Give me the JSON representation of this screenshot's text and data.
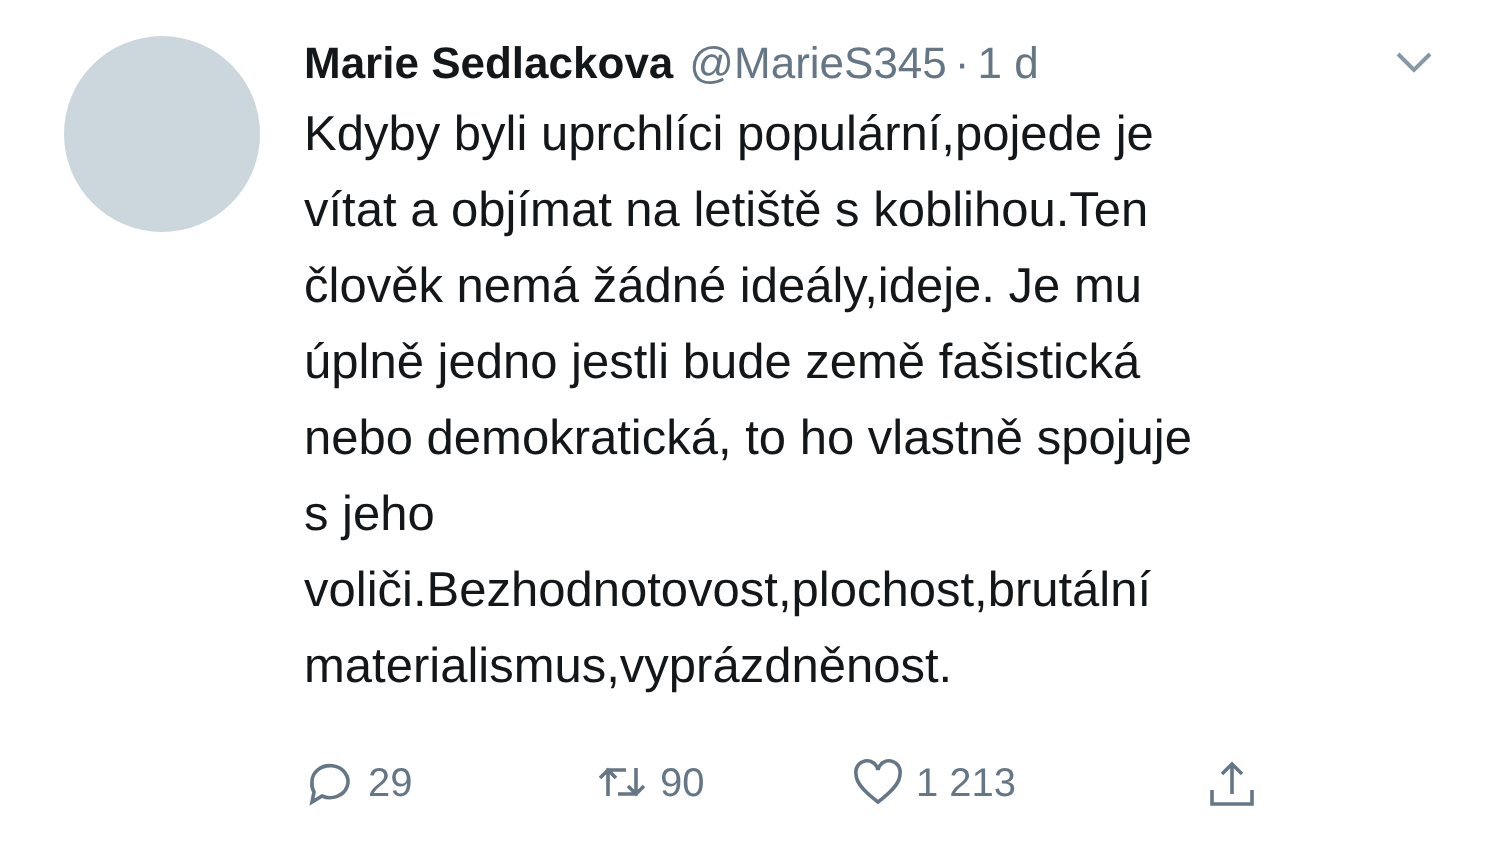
{
  "tweet": {
    "name": "Marie Sedlackova",
    "handle": "@MarieS345",
    "separator": "·",
    "time": "1 d",
    "text": "Kdyby byli uprchlíci populární,pojede je\nvítat a objímat na letiště s koblihou.Ten\nčlověk nemá žádné ideály,ideje. Je mu\núplně jedno jestli bude země fašistická\nnebo demokratická, to ho vlastně spojuje\ns jeho\nvoliči.Bezhodnotovost,plochost,brutální\nmaterialismus,vyprázdněnost.",
    "actions": [
      {
        "kind": "reply",
        "count": "29"
      },
      {
        "kind": "retweet",
        "count": "90"
      },
      {
        "kind": "like",
        "count": "1 213"
      },
      {
        "kind": "share"
      }
    ]
  }
}
